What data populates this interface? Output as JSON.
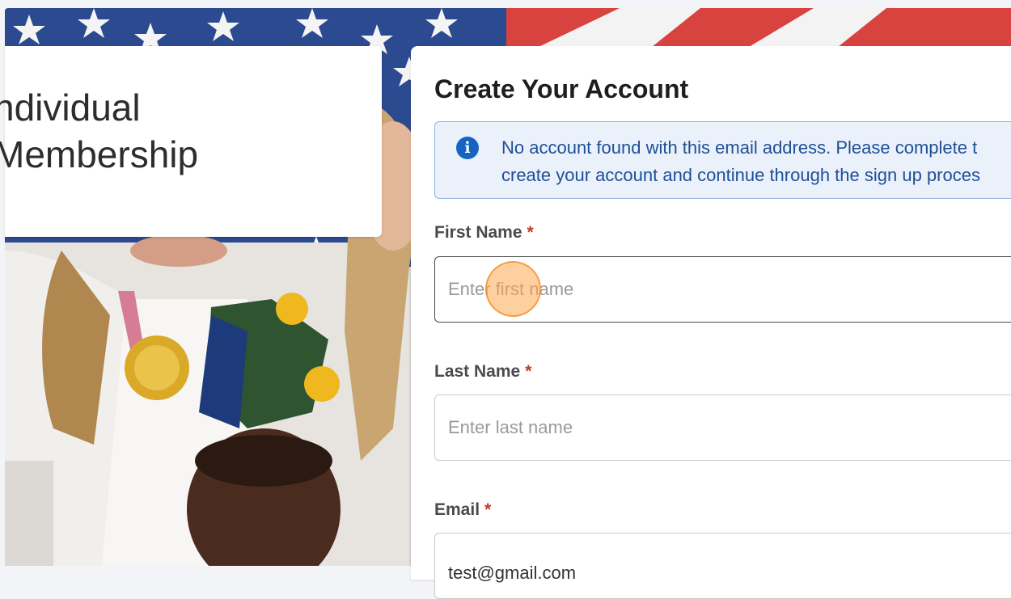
{
  "title_card": {
    "line1": "ndividual",
    "line2": "Membership"
  },
  "form": {
    "heading": "Create Your Account",
    "alert": {
      "icon": "info-icon",
      "line1": "No account found with this email address. Please complete t",
      "line2": "create your account and continue through the sign up proces"
    },
    "first_name": {
      "label": "First Name",
      "required": "*",
      "placeholder": "Enter first name",
      "value": ""
    },
    "last_name": {
      "label": "Last Name",
      "required": "*",
      "placeholder": "Enter last name",
      "value": ""
    },
    "email": {
      "label": "Email",
      "required": "*",
      "value": "test@gmail.com"
    }
  },
  "colors": {
    "alert_bg": "#eaf1fb",
    "alert_text": "#1f4f97",
    "info_icon": "#1565c0",
    "required_marker": "#c0392b"
  }
}
